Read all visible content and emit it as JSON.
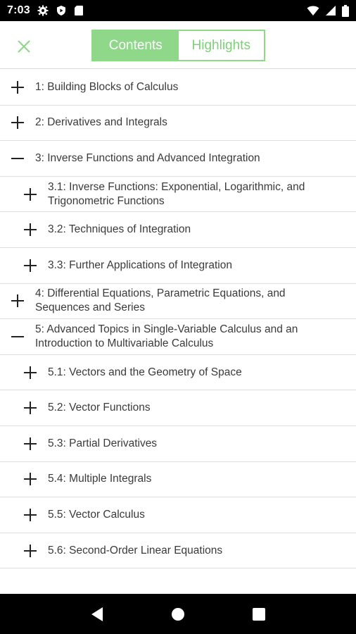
{
  "status_bar": {
    "time": "7:03",
    "icons_left": [
      "gear-icon",
      "play-protect-icon",
      "sd-card-icon"
    ],
    "icons_right": [
      "wifi-icon",
      "signal-icon",
      "battery-icon"
    ]
  },
  "header": {
    "close_icon": "close-icon",
    "tabs": [
      {
        "label": "Contents",
        "active": true
      },
      {
        "label": "Highlights",
        "active": false
      }
    ]
  },
  "toc": {
    "items": [
      {
        "label": "1: Building Blocks of Calculus",
        "level": 0,
        "expanded": false
      },
      {
        "label": "2: Derivatives and Integrals",
        "level": 0,
        "expanded": false
      },
      {
        "label": "3: Inverse Functions and Advanced Integration",
        "level": 0,
        "expanded": true
      },
      {
        "label": "3.1: Inverse Functions: Exponential, Logarithmic, and Trigonometric Functions",
        "level": 1,
        "expanded": false
      },
      {
        "label": "3.2: Techniques of Integration",
        "level": 1,
        "expanded": false
      },
      {
        "label": "3.3: Further Applications of Integration",
        "level": 1,
        "expanded": false
      },
      {
        "label": "4: Differential Equations, Parametric Equations, and Sequences and Series",
        "level": 0,
        "expanded": false
      },
      {
        "label": "5: Advanced Topics in Single-Variable Calculus and an Introduction to Multivariable Calculus",
        "level": 0,
        "expanded": true
      },
      {
        "label": "5.1: Vectors and the Geometry of Space",
        "level": 1,
        "expanded": false
      },
      {
        "label": "5.2: Vector Functions",
        "level": 1,
        "expanded": false
      },
      {
        "label": "5.3: Partial Derivatives",
        "level": 1,
        "expanded": false
      },
      {
        "label": "5.4: Multiple Integrals",
        "level": 1,
        "expanded": false
      },
      {
        "label": "5.5: Vector Calculus",
        "level": 1,
        "expanded": false
      },
      {
        "label": "5.6: Second-Order Linear Equations",
        "level": 1,
        "expanded": false
      }
    ]
  },
  "nav_bar": {
    "buttons": [
      "back-icon",
      "home-icon",
      "recents-icon"
    ]
  },
  "colors": {
    "accent": "#8fd88a",
    "accent_text": "#7fcf7a",
    "text": "#3a3a3a",
    "divider": "#dedede"
  }
}
